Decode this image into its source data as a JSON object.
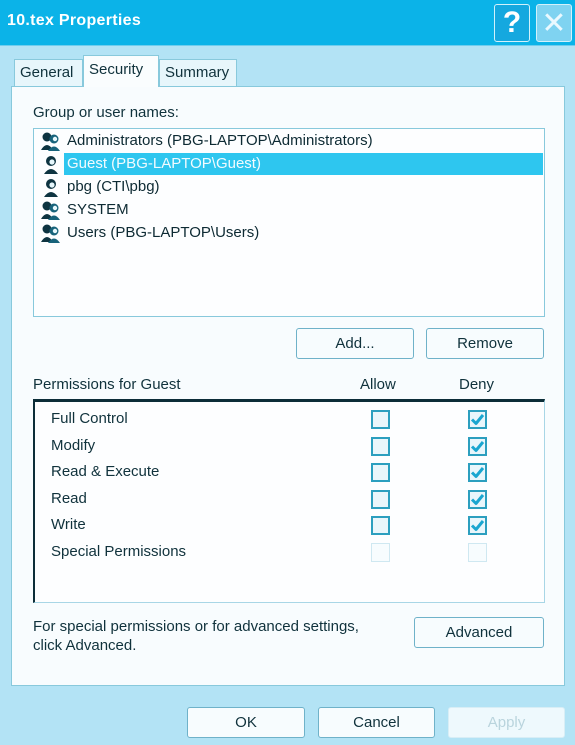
{
  "window": {
    "title": "10.tex Properties",
    "help_label": "?",
    "close_label": "✕"
  },
  "tabs": [
    {
      "label": "General",
      "active": false
    },
    {
      "label": "Security",
      "active": true
    },
    {
      "label": "Summary",
      "active": false
    }
  ],
  "security": {
    "group_label": "Group or user names:",
    "users": [
      {
        "name": "Administrators (PBG-LAPTOP\\Administrators)",
        "icon": "group-users-icon",
        "selected": false
      },
      {
        "name": "Guest (PBG-LAPTOP\\Guest)",
        "icon": "user-icon",
        "selected": true
      },
      {
        "name": "pbg (CTI\\pbg)",
        "icon": "user-icon",
        "selected": false
      },
      {
        "name": "SYSTEM",
        "icon": "group-users-icon",
        "selected": false
      },
      {
        "name": "Users (PBG-LAPTOP\\Users)",
        "icon": "group-users-icon",
        "selected": false
      }
    ],
    "add_label": "Add...",
    "remove_label": "Remove",
    "permissions_for_label": "Permissions for Guest",
    "allow_header": "Allow",
    "deny_header": "Deny",
    "permissions": [
      {
        "name": "Full Control",
        "allow": false,
        "deny": true,
        "enabled": true
      },
      {
        "name": "Modify",
        "allow": false,
        "deny": true,
        "enabled": true
      },
      {
        "name": "Read & Execute",
        "allow": false,
        "deny": true,
        "enabled": true
      },
      {
        "name": "Read",
        "allow": false,
        "deny": true,
        "enabled": true
      },
      {
        "name": "Write",
        "allow": false,
        "deny": true,
        "enabled": true
      },
      {
        "name": "Special Permissions",
        "allow": false,
        "deny": false,
        "enabled": false
      }
    ],
    "advanced_text_line1": "For special permissions or for advanced settings,",
    "advanced_text_line2": "click Advanced.",
    "advanced_label": "Advanced"
  },
  "footer": {
    "ok_label": "OK",
    "cancel_label": "Cancel",
    "apply_label": "Apply",
    "apply_enabled": false
  },
  "colors": {
    "titlebar": "#0bb3e8",
    "selection": "#2ec6ef",
    "check": "#1aa6d0"
  }
}
